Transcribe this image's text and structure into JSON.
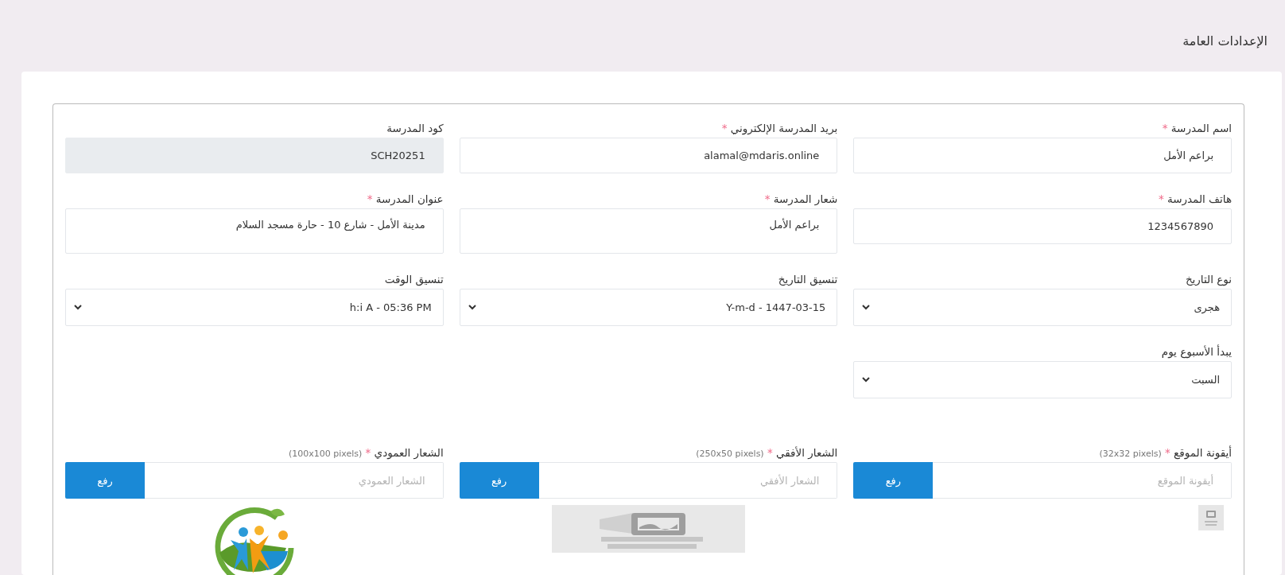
{
  "page": {
    "title": "الإعدادات العامة"
  },
  "fields": [
    {
      "kind": "text",
      "label": "اسم المدرسة",
      "required_mark": "*",
      "value": "براعم الأمل"
    },
    {
      "kind": "text",
      "label": "بريد المدرسة الإلكتروني",
      "required_mark": "*",
      "value": "alamal@mdaris.online"
    },
    {
      "kind": "readonly",
      "label": "كود المدرسة",
      "value": "SCH20251"
    },
    {
      "kind": "text",
      "label": "هاتف المدرسة",
      "required_mark": "*",
      "value": "1234567890"
    },
    {
      "kind": "textarea",
      "label": "شعار المدرسة",
      "required_mark": "*",
      "value": "براعم الأمل"
    },
    {
      "kind": "textarea",
      "label": "عنوان المدرسة",
      "required_mark": "*",
      "value": "مدينة الأمل - شارع 10 - حارة مسجد السلام"
    },
    {
      "kind": "select",
      "label": "نوع التاريخ",
      "value": "هجرى"
    },
    {
      "kind": "select",
      "label": "تنسيق التاريخ",
      "value": "Y-m-d - 1447-03-15"
    },
    {
      "kind": "select",
      "label": "تنسيق الوقت",
      "value": "h:i A - 05:36 PM"
    },
    {
      "kind": "select",
      "label": "يبدأ الأسبوع يوم",
      "value": "السبت"
    }
  ],
  "uploads": [
    {
      "kind": "thumbnail",
      "label": "أيقونة الموقع",
      "required_mark": "*",
      "hint": "(32x32 pixels)",
      "placeholder": "أيقونة الموقع",
      "button": "رفع"
    },
    {
      "kind": "no-image",
      "label": "الشعار الأفقي",
      "required_mark": "*",
      "hint": "(250x50 pixels)",
      "placeholder": "الشعار الأفقي",
      "button": "رفع"
    },
    {
      "kind": "logo",
      "label": "الشعار العمودي",
      "required_mark": "*",
      "hint": "(100x100 pixels)",
      "placeholder": "الشعار العمودي",
      "button": "رفع"
    }
  ]
}
